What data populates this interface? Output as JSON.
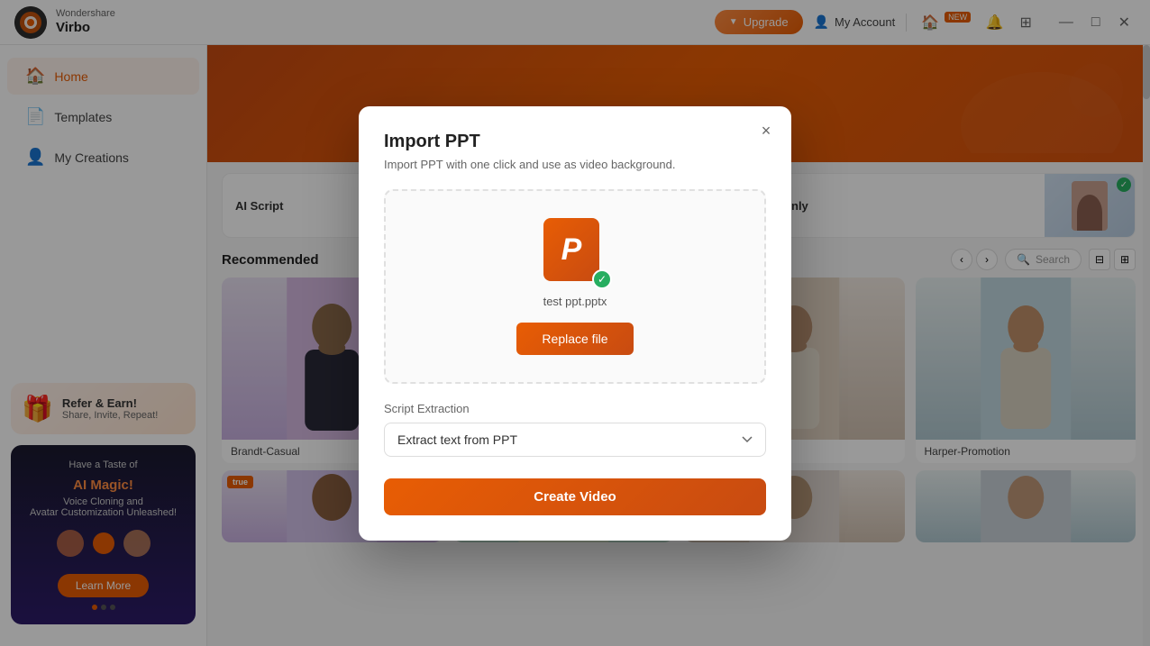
{
  "app": {
    "brand": "Wondershare",
    "product": "Virbo"
  },
  "titlebar": {
    "upgrade_label": "Upgrade",
    "account_label": "My Account",
    "new_badge": "NEW"
  },
  "sidebar": {
    "items": [
      {
        "id": "home",
        "label": "Home",
        "icon": "🏠",
        "active": true
      },
      {
        "id": "templates",
        "label": "Templates",
        "icon": "📄"
      },
      {
        "id": "my-creations",
        "label": "My Creations",
        "icon": "👤"
      }
    ],
    "refer": {
      "title": "Refer & Earn!",
      "subtitle": "Share, Invite, Repeat!"
    },
    "ai_magic": {
      "title_plain": "Have a Taste of",
      "title_highlight": "AI Magic!",
      "subtitle": "Voice Cloning and\nAvatar Customization Unleashed!",
      "learn_more": "Learn More"
    }
  },
  "main": {
    "feature_cards": [
      {
        "id": "ai-script",
        "title": "AI Script",
        "subtitle": ""
      },
      {
        "id": "export-avatar",
        "title": "Export Avatar Only",
        "subtitle": ""
      }
    ],
    "recommended_section": {
      "title": "Recommended",
      "search_placeholder": "Search"
    },
    "avatars": [
      {
        "id": "1",
        "name": "Brandt-Casual",
        "hot": false,
        "bg": "bg1"
      },
      {
        "id": "2",
        "name": "",
        "hot": false,
        "bg": "bg2"
      },
      {
        "id": "3",
        "name": "",
        "hot": false,
        "bg": "bg3"
      },
      {
        "id": "4",
        "name": "Harper-Promotion",
        "hot": false,
        "bg": "bg4"
      },
      {
        "id": "5",
        "name": "",
        "hot": true,
        "bg": "bg1"
      },
      {
        "id": "6",
        "name": "",
        "hot": false,
        "bg": "bg2"
      },
      {
        "id": "7",
        "name": "",
        "hot": false,
        "bg": "bg3"
      },
      {
        "id": "8",
        "name": "",
        "hot": false,
        "bg": "bg4"
      }
    ]
  },
  "modal": {
    "title": "Import PPT",
    "subtitle": "Import PPT with one click and use as video background.",
    "file_name": "test ppt.pptx",
    "replace_btn": "Replace file",
    "script_extraction_label": "Script Extraction",
    "script_option": "Extract text from PPT",
    "create_video_btn": "Create Video",
    "close_icon": "×"
  }
}
